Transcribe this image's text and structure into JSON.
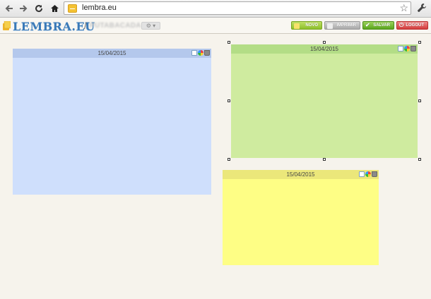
{
  "browser": {
    "url": "lembra.eu",
    "back_icon": "arrow-left-icon",
    "forward_icon": "arrow-right-icon",
    "reload_icon": "reload-icon",
    "home_icon": "home-icon",
    "bookmark_icon": "star-icon",
    "menu_icon": "wrench-icon"
  },
  "app": {
    "logo_text": "LEMBRA.EU",
    "separator": "/",
    "username": "PUTABACADA",
    "settings_icon": "gear-icon"
  },
  "toolbar": {
    "novo_label": "NOVO",
    "imprimir_label": "IMPRIMIR",
    "salvar_label": "SALVAR",
    "logout_label": "LOGOUT"
  },
  "notes": [
    {
      "id": "blue",
      "date": "15/04/2015",
      "header_color": "#b4c8ec",
      "body_color": "#cfdffc",
      "content": ""
    },
    {
      "id": "green",
      "date": "15/04/2015",
      "header_color": "#b3dd86",
      "body_color": "#cfeb9f",
      "content": "",
      "selected": true
    },
    {
      "id": "yellow",
      "date": "15/04/2015",
      "header_color": "#ebe77a",
      "body_color": "#fefe85",
      "content": ""
    }
  ],
  "colors": {
    "accent_blue": "#3a7ab8",
    "novo_green": "#8cbf2a",
    "salvar_green": "#5aa51e",
    "logout_red": "#d23c3c",
    "page_background": "#f6f3ec"
  }
}
